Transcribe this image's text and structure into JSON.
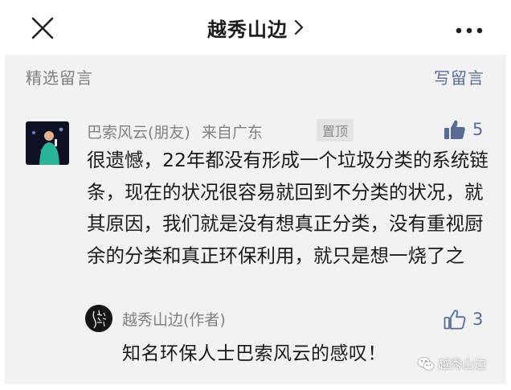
{
  "header": {
    "title": "越秀山边",
    "close_icon": "close-icon",
    "chevron_icon": "chevron-right-icon",
    "more_icon": "more-dots-icon"
  },
  "comments_section": {
    "label": "精选留言",
    "write_label": "写留言",
    "link_color": "#576b95"
  },
  "comment": {
    "author": "巴索风云(朋友)",
    "location": "来自广东",
    "pinned_label": "置顶",
    "likes": "5",
    "text": "很遗憾，22年都没有形成一个垃圾分类的系统链条，现在的状况很容易就回到不分类的状况，就其原因，我们就是没有想真正分类，没有重视厨余的分类和真正环保利用，就只是想一烧了之"
  },
  "reply": {
    "author": "越秀山边(作者)",
    "likes": "3",
    "text": "知名环保人士巴索风云的感叹！"
  },
  "watermark": {
    "text": "越秀山边",
    "icon": "wechat-icon"
  }
}
